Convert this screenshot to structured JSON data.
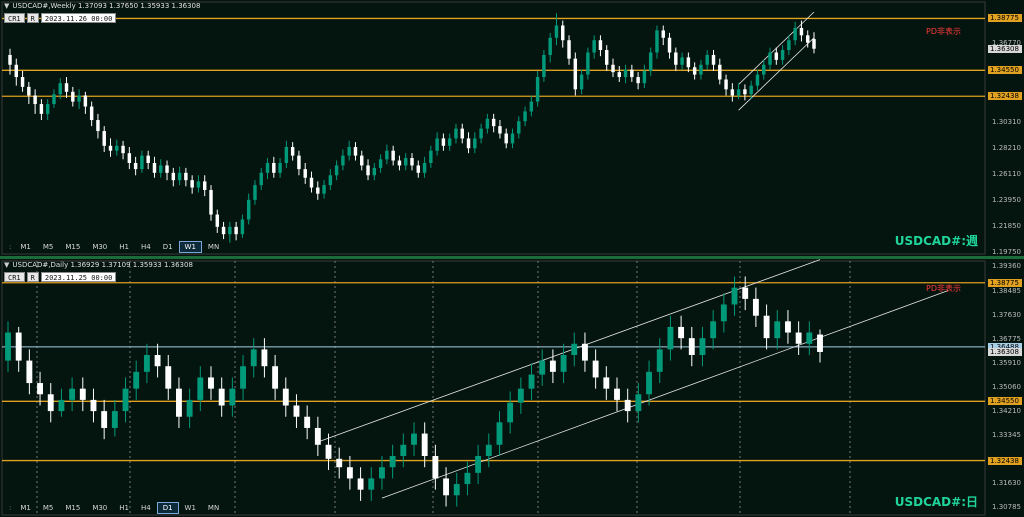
{
  "colors": {
    "bull": "#009a7a",
    "bear": "#ffffff",
    "hline": "#e0a020",
    "bid": "#a8cfe8",
    "channel": "#e8e8e8",
    "background": "#04140e"
  },
  "common": {
    "cr_label": "CR1",
    "r_label": "R",
    "timeframes": [
      "M1",
      "M5",
      "M15",
      "M30",
      "H1",
      "H4",
      "D1",
      "W1",
      "MN"
    ],
    "pd_label": "PD非表示",
    "menu_icon": "triangle-down-icon"
  },
  "weekly": {
    "title": "USDCAD#,Weekly  1.37093 1.37650 1.35933 1.36308",
    "datetime": "2023.11.26 00:00",
    "active_tf": "W1",
    "watermark": "USDCAD#:週",
    "price_axis": [
      "1.38775",
      "1.36770",
      "1.34550",
      "1.32438",
      "1.30310",
      "1.28210",
      "1.26110",
      "1.23950",
      "1.21850",
      "1.19750"
    ],
    "price_range": [
      1.1975,
      1.3995
    ],
    "hlines": [
      {
        "price": 1.38775,
        "label": "1.38775"
      },
      {
        "price": 1.3455,
        "label": "1.34550"
      },
      {
        "price": 1.32438,
        "label": "1.32438"
      }
    ],
    "current": {
      "price": 1.36308,
      "label": "1.36308"
    },
    "candles": [
      [
        1.358,
        1.35,
        1.363,
        1.342
      ],
      [
        1.35,
        1.34,
        1.355,
        1.333
      ],
      [
        1.34,
        1.332,
        1.345,
        1.328
      ],
      [
        1.332,
        1.325,
        1.336,
        1.318
      ],
      [
        1.325,
        1.318,
        1.33,
        1.31
      ],
      [
        1.318,
        1.31,
        1.322,
        1.305
      ],
      [
        1.31,
        1.318,
        1.322,
        1.305
      ],
      [
        1.318,
        1.326,
        1.33,
        1.315
      ],
      [
        1.326,
        1.335,
        1.339,
        1.322
      ],
      [
        1.335,
        1.328,
        1.34,
        1.323
      ],
      [
        1.328,
        1.32,
        1.332,
        1.316
      ],
      [
        1.32,
        1.325,
        1.33,
        1.314
      ],
      [
        1.325,
        1.316,
        1.328,
        1.31
      ],
      [
        1.316,
        1.305,
        1.32,
        1.3
      ],
      [
        1.305,
        1.296,
        1.31,
        1.29
      ],
      [
        1.296,
        1.284,
        1.3,
        1.279
      ],
      [
        1.284,
        1.28,
        1.29,
        1.275
      ],
      [
        1.28,
        1.284,
        1.289,
        1.276
      ],
      [
        1.284,
        1.278,
        1.288,
        1.273
      ],
      [
        1.278,
        1.27,
        1.283,
        1.265
      ],
      [
        1.27,
        1.265,
        1.275,
        1.26
      ],
      [
        1.265,
        1.276,
        1.28,
        1.262
      ],
      [
        1.276,
        1.27,
        1.28,
        1.265
      ],
      [
        1.27,
        1.262,
        1.275,
        1.258
      ],
      [
        1.262,
        1.268,
        1.273,
        1.258
      ],
      [
        1.268,
        1.262,
        1.272,
        1.256
      ],
      [
        1.262,
        1.256,
        1.266,
        1.251
      ],
      [
        1.256,
        1.262,
        1.267,
        1.252
      ],
      [
        1.262,
        1.256,
        1.266,
        1.251
      ],
      [
        1.256,
        1.25,
        1.26,
        1.245
      ],
      [
        1.25,
        1.255,
        1.26,
        1.246
      ],
      [
        1.255,
        1.248,
        1.26,
        1.243
      ],
      [
        1.248,
        1.228,
        1.252,
        1.223
      ],
      [
        1.228,
        1.218,
        1.232,
        1.213
      ],
      [
        1.218,
        1.212,
        1.222,
        1.208
      ],
      [
        1.212,
        1.218,
        1.222,
        1.205
      ],
      [
        1.218,
        1.212,
        1.222,
        1.207
      ],
      [
        1.212,
        1.224,
        1.228,
        1.209
      ],
      [
        1.224,
        1.24,
        1.245,
        1.22
      ],
      [
        1.24,
        1.252,
        1.256,
        1.236
      ],
      [
        1.252,
        1.262,
        1.266,
        1.248
      ],
      [
        1.262,
        1.27,
        1.274,
        1.257
      ],
      [
        1.27,
        1.262,
        1.275,
        1.258
      ],
      [
        1.262,
        1.27,
        1.274,
        1.258
      ],
      [
        1.27,
        1.283,
        1.288,
        1.266
      ],
      [
        1.283,
        1.276,
        1.287,
        1.272
      ],
      [
        1.276,
        1.265,
        1.28,
        1.26
      ],
      [
        1.265,
        1.258,
        1.27,
        1.253
      ],
      [
        1.258,
        1.25,
        1.263,
        1.246
      ],
      [
        1.25,
        1.245,
        1.255,
        1.24
      ],
      [
        1.245,
        1.252,
        1.256,
        1.241
      ],
      [
        1.252,
        1.26,
        1.265,
        1.248
      ],
      [
        1.26,
        1.268,
        1.272,
        1.256
      ],
      [
        1.268,
        1.276,
        1.281,
        1.264
      ],
      [
        1.276,
        1.283,
        1.288,
        1.272
      ],
      [
        1.283,
        1.276,
        1.287,
        1.272
      ],
      [
        1.276,
        1.268,
        1.28,
        1.264
      ],
      [
        1.268,
        1.26,
        1.273,
        1.256
      ],
      [
        1.26,
        1.266,
        1.27,
        1.256
      ],
      [
        1.266,
        1.273,
        1.277,
        1.262
      ],
      [
        1.273,
        1.28,
        1.285,
        1.269
      ],
      [
        1.28,
        1.272,
        1.284,
        1.268
      ],
      [
        1.272,
        1.268,
        1.276,
        1.264
      ],
      [
        1.268,
        1.274,
        1.278,
        1.264
      ],
      [
        1.274,
        1.268,
        1.278,
        1.264
      ],
      [
        1.268,
        1.262,
        1.272,
        1.258
      ],
      [
        1.262,
        1.27,
        1.275,
        1.258
      ],
      [
        1.27,
        1.28,
        1.284,
        1.266
      ],
      [
        1.28,
        1.29,
        1.295,
        1.276
      ],
      [
        1.29,
        1.284,
        1.294,
        1.28
      ],
      [
        1.284,
        1.29,
        1.294,
        1.28
      ],
      [
        1.29,
        1.298,
        1.302,
        1.286
      ],
      [
        1.298,
        1.29,
        1.302,
        1.286
      ],
      [
        1.29,
        1.282,
        1.295,
        1.278
      ],
      [
        1.282,
        1.29,
        1.295,
        1.278
      ],
      [
        1.29,
        1.298,
        1.302,
        1.286
      ],
      [
        1.298,
        1.306,
        1.31,
        1.294
      ],
      [
        1.306,
        1.3,
        1.31,
        1.295
      ],
      [
        1.3,
        1.294,
        1.305,
        1.29
      ],
      [
        1.294,
        1.286,
        1.298,
        1.282
      ],
      [
        1.286,
        1.294,
        1.298,
        1.282
      ],
      [
        1.294,
        1.304,
        1.308,
        1.29
      ],
      [
        1.304,
        1.312,
        1.316,
        1.3
      ],
      [
        1.312,
        1.32,
        1.325,
        1.308
      ],
      [
        1.32,
        1.34,
        1.345,
        1.316
      ],
      [
        1.34,
        1.358,
        1.362,
        1.336
      ],
      [
        1.358,
        1.372,
        1.376,
        1.352
      ],
      [
        1.372,
        1.382,
        1.392,
        1.366
      ],
      [
        1.382,
        1.37,
        1.386,
        1.364
      ],
      [
        1.37,
        1.355,
        1.374,
        1.35
      ],
      [
        1.355,
        1.33,
        1.36,
        1.325
      ],
      [
        1.33,
        1.342,
        1.346,
        1.326
      ],
      [
        1.342,
        1.36,
        1.364,
        1.338
      ],
      [
        1.36,
        1.37,
        1.374,
        1.355
      ],
      [
        1.37,
        1.362,
        1.374,
        1.357
      ],
      [
        1.362,
        1.35,
        1.366,
        1.345
      ],
      [
        1.35,
        1.344,
        1.355,
        1.34
      ],
      [
        1.344,
        1.34,
        1.349,
        1.336
      ],
      [
        1.34,
        1.346,
        1.35,
        1.335
      ],
      [
        1.346,
        1.34,
        1.35,
        1.336
      ],
      [
        1.34,
        1.335,
        1.344,
        1.33
      ],
      [
        1.335,
        1.345,
        1.35,
        1.331
      ],
      [
        1.345,
        1.36,
        1.364,
        1.341
      ],
      [
        1.36,
        1.378,
        1.382,
        1.355
      ],
      [
        1.378,
        1.372,
        1.382,
        1.366
      ],
      [
        1.372,
        1.36,
        1.376,
        1.355
      ],
      [
        1.36,
        1.35,
        1.364,
        1.345
      ],
      [
        1.35,
        1.356,
        1.36,
        1.346
      ],
      [
        1.356,
        1.348,
        1.36,
        1.344
      ],
      [
        1.348,
        1.342,
        1.352,
        1.338
      ],
      [
        1.342,
        1.35,
        1.354,
        1.338
      ],
      [
        1.35,
        1.358,
        1.362,
        1.346
      ],
      [
        1.358,
        1.35,
        1.362,
        1.345
      ],
      [
        1.35,
        1.338,
        1.355,
        1.334
      ],
      [
        1.338,
        1.33,
        1.342,
        1.325
      ],
      [
        1.33,
        1.325,
        1.335,
        1.32
      ],
      [
        1.325,
        1.33,
        1.335,
        1.322
      ],
      [
        1.33,
        1.326,
        1.334,
        1.321
      ],
      [
        1.326,
        1.333,
        1.337,
        1.322
      ],
      [
        1.333,
        1.342,
        1.346,
        1.329
      ],
      [
        1.342,
        1.35,
        1.354,
        1.338
      ],
      [
        1.35,
        1.36,
        1.364,
        1.346
      ],
      [
        1.36,
        1.354,
        1.364,
        1.35
      ],
      [
        1.354,
        1.362,
        1.366,
        1.35
      ],
      [
        1.362,
        1.37,
        1.374,
        1.358
      ],
      [
        1.37,
        1.38,
        1.385,
        1.366
      ],
      [
        1.38,
        1.374,
        1.386,
        1.369
      ],
      [
        1.374,
        1.368,
        1.378,
        1.364
      ],
      [
        1.37093,
        1.36308,
        1.3765,
        1.35933
      ]
    ]
  },
  "daily": {
    "title": "USDCAD#,Daily  1.36929 1.37109 1.35933 1.36308",
    "datetime": "2023.11.25 00:00",
    "active_tf": "D1",
    "watermark": "USDCAD#:日",
    "price_axis": [
      "1.39360",
      "1.38775",
      "1.38485",
      "1.37630",
      "1.36775",
      "1.36488",
      "1.36308",
      "1.35910",
      "1.35060",
      "1.34550",
      "1.34210",
      "1.33345",
      "1.32438",
      "1.31630",
      "1.30785"
    ],
    "price_range": [
      1.3064,
      1.3955
    ],
    "hlines": [
      {
        "price": 1.38775,
        "label": "1.38775"
      },
      {
        "price": 1.3455,
        "label": "1.34550"
      },
      {
        "price": 1.32438,
        "label": "1.32438"
      }
    ],
    "bid": {
      "price": 1.36488,
      "label": "1.36488"
    },
    "current": {
      "price": 1.36308,
      "label": "1.36308"
    },
    "candles": [
      [
        1.36,
        1.37,
        1.374,
        1.356
      ],
      [
        1.37,
        1.36,
        1.372,
        1.356
      ],
      [
        1.36,
        1.352,
        1.364,
        1.348
      ],
      [
        1.352,
        1.348,
        1.356,
        1.344
      ],
      [
        1.348,
        1.342,
        1.352,
        1.338
      ],
      [
        1.342,
        1.346,
        1.35,
        1.34
      ],
      [
        1.346,
        1.35,
        1.354,
        1.342
      ],
      [
        1.35,
        1.346,
        1.354,
        1.342
      ],
      [
        1.346,
        1.342,
        1.35,
        1.338
      ],
      [
        1.342,
        1.336,
        1.346,
        1.332
      ],
      [
        1.336,
        1.342,
        1.346,
        1.333
      ],
      [
        1.342,
        1.35,
        1.354,
        1.338
      ],
      [
        1.35,
        1.356,
        1.36,
        1.346
      ],
      [
        1.356,
        1.362,
        1.366,
        1.352
      ],
      [
        1.362,
        1.358,
        1.366,
        1.354
      ],
      [
        1.358,
        1.35,
        1.362,
        1.346
      ],
      [
        1.35,
        1.34,
        1.354,
        1.336
      ],
      [
        1.34,
        1.346,
        1.35,
        1.336
      ],
      [
        1.346,
        1.354,
        1.358,
        1.342
      ],
      [
        1.354,
        1.35,
        1.358,
        1.346
      ],
      [
        1.35,
        1.344,
        1.354,
        1.34
      ],
      [
        1.344,
        1.35,
        1.354,
        1.34
      ],
      [
        1.35,
        1.358,
        1.362,
        1.346
      ],
      [
        1.358,
        1.364,
        1.368,
        1.354
      ],
      [
        1.364,
        1.358,
        1.368,
        1.354
      ],
      [
        1.358,
        1.35,
        1.362,
        1.346
      ],
      [
        1.35,
        1.344,
        1.354,
        1.34
      ],
      [
        1.344,
        1.34,
        1.348,
        1.336
      ],
      [
        1.34,
        1.336,
        1.344,
        1.332
      ],
      [
        1.336,
        1.33,
        1.34,
        1.326
      ],
      [
        1.33,
        1.325,
        1.334,
        1.321
      ],
      [
        1.325,
        1.322,
        1.329,
        1.318
      ],
      [
        1.322,
        1.318,
        1.326,
        1.314
      ],
      [
        1.318,
        1.314,
        1.322,
        1.31
      ],
      [
        1.314,
        1.318,
        1.322,
        1.31
      ],
      [
        1.318,
        1.322,
        1.326,
        1.314
      ],
      [
        1.322,
        1.326,
        1.33,
        1.318
      ],
      [
        1.326,
        1.33,
        1.334,
        1.322
      ],
      [
        1.33,
        1.334,
        1.338,
        1.326
      ],
      [
        1.334,
        1.326,
        1.338,
        1.322
      ],
      [
        1.326,
        1.318,
        1.33,
        1.314
      ],
      [
        1.318,
        1.312,
        1.322,
        1.308
      ],
      [
        1.312,
        1.316,
        1.32,
        1.308
      ],
      [
        1.316,
        1.32,
        1.324,
        1.312
      ],
      [
        1.32,
        1.326,
        1.33,
        1.316
      ],
      [
        1.326,
        1.33,
        1.334,
        1.322
      ],
      [
        1.33,
        1.338,
        1.342,
        1.326
      ],
      [
        1.338,
        1.345,
        1.349,
        1.334
      ],
      [
        1.345,
        1.35,
        1.354,
        1.341
      ],
      [
        1.35,
        1.355,
        1.359,
        1.346
      ],
      [
        1.355,
        1.36,
        1.364,
        1.351
      ],
      [
        1.36,
        1.356,
        1.364,
        1.352
      ],
      [
        1.356,
        1.362,
        1.366,
        1.352
      ],
      [
        1.362,
        1.366,
        1.37,
        1.358
      ],
      [
        1.366,
        1.36,
        1.37,
        1.356
      ],
      [
        1.36,
        1.354,
        1.364,
        1.35
      ],
      [
        1.354,
        1.35,
        1.358,
        1.346
      ],
      [
        1.35,
        1.346,
        1.354,
        1.342
      ],
      [
        1.346,
        1.342,
        1.35,
        1.338
      ],
      [
        1.342,
        1.348,
        1.352,
        1.338
      ],
      [
        1.348,
        1.356,
        1.36,
        1.344
      ],
      [
        1.356,
        1.364,
        1.368,
        1.352
      ],
      [
        1.364,
        1.372,
        1.376,
        1.36
      ],
      [
        1.372,
        1.368,
        1.376,
        1.364
      ],
      [
        1.368,
        1.362,
        1.372,
        1.358
      ],
      [
        1.362,
        1.368,
        1.372,
        1.358
      ],
      [
        1.368,
        1.374,
        1.378,
        1.364
      ],
      [
        1.374,
        1.38,
        1.384,
        1.37
      ],
      [
        1.38,
        1.386,
        1.39,
        1.376
      ],
      [
        1.386,
        1.382,
        1.39,
        1.378
      ],
      [
        1.382,
        1.376,
        1.386,
        1.372
      ],
      [
        1.376,
        1.368,
        1.38,
        1.364
      ],
      [
        1.368,
        1.374,
        1.378,
        1.364
      ],
      [
        1.374,
        1.37,
        1.378,
        1.366
      ],
      [
        1.37,
        1.366,
        1.374,
        1.362
      ],
      [
        1.366,
        1.37,
        1.374,
        1.362
      ],
      [
        1.36929,
        1.36308,
        1.37109,
        1.35933
      ]
    ]
  }
}
